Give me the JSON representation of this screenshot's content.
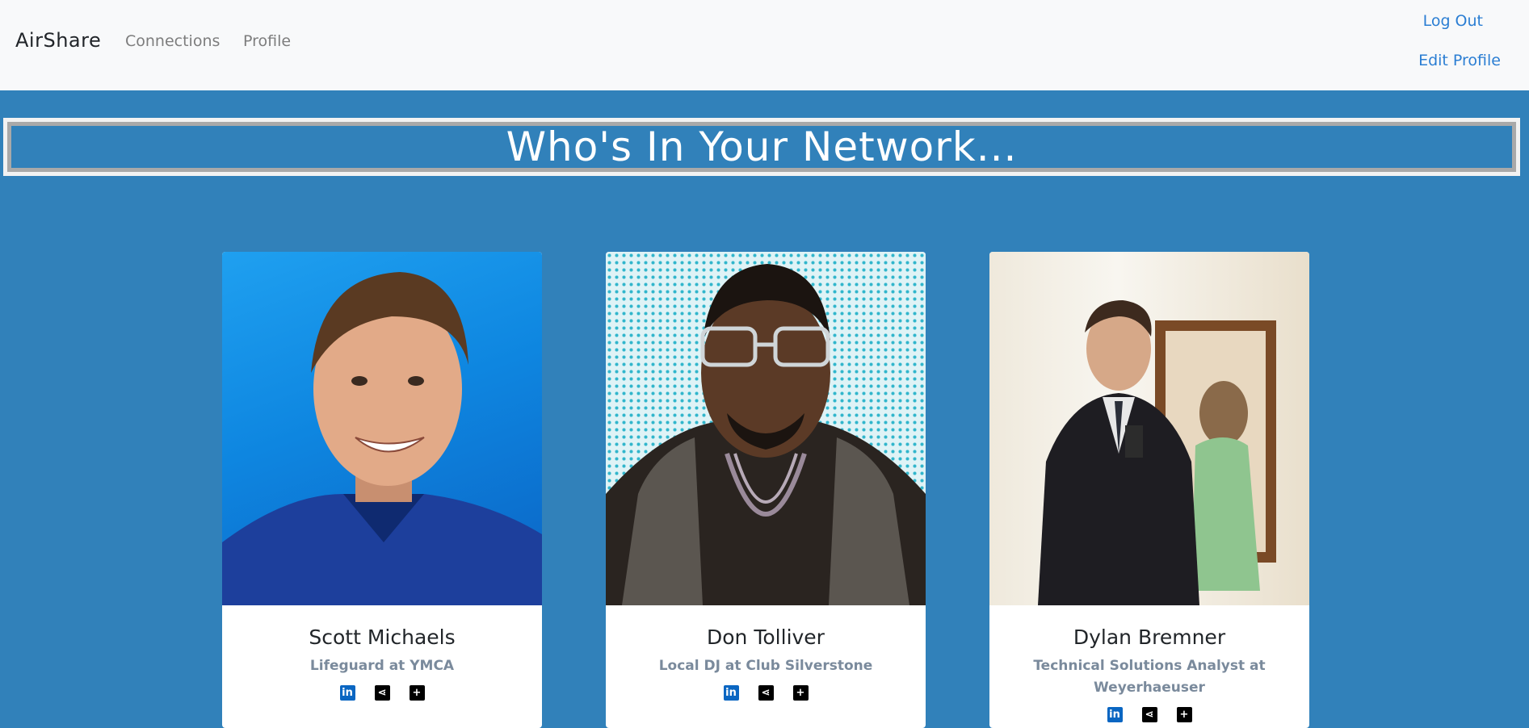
{
  "navbar": {
    "brand": "AirShare",
    "links": [
      "Connections",
      "Profile"
    ],
    "right": {
      "logout": "Log Out",
      "edit_profile": "Edit Profile"
    }
  },
  "banner": {
    "title": "Who's In Your Network..."
  },
  "cards": [
    {
      "name": "Scott Michaels",
      "title": "Lifeguard at YMCA"
    },
    {
      "name": "Don Tolliver",
      "title": "Local DJ at Club Silverstone"
    },
    {
      "name": "Dylan Bremner",
      "title": "Technical Solutions Analyst at Weyerhaeuser"
    }
  ],
  "icons": {
    "linkedin": "linkedin-icon",
    "share": "share-icon",
    "add": "plus-square-icon"
  },
  "colors": {
    "background": "#3181ba",
    "navbar": "#f8f9fa",
    "link_blue": "#2b7ed3",
    "muted_title": "#7a8a9c"
  }
}
